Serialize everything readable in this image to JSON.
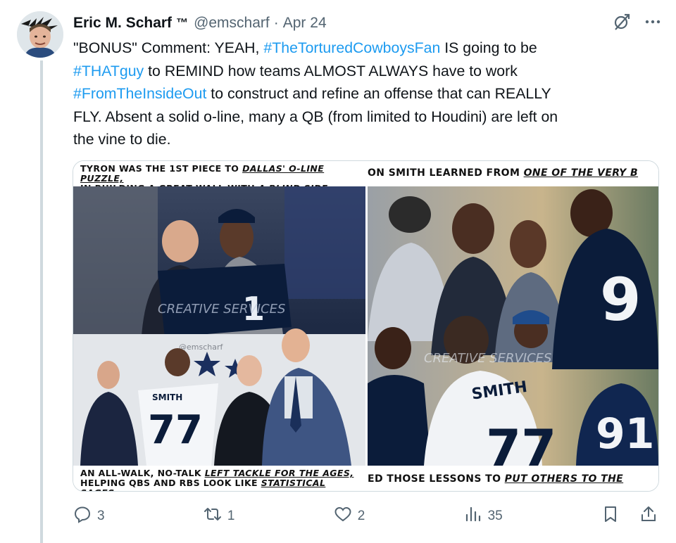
{
  "author": {
    "name": "Eric M. Scharf",
    "tm": "™",
    "handle": "@emscharf",
    "separator": "·",
    "date": "Apr 24"
  },
  "tweet": {
    "segments": [
      {
        "text": "\"BONUS\" Comment: YEAH, ",
        "type": "text"
      },
      {
        "text": "#TheTorturedCowboysFan",
        "type": "hashtag"
      },
      {
        "text": " IS going to be\n",
        "type": "text"
      },
      {
        "text": "#THATguy",
        "type": "hashtag"
      },
      {
        "text": " to REMIND how teams ALMOST ALWAYS have to work\n",
        "type": "text"
      },
      {
        "text": "#FromTheInsideOut",
        "type": "hashtag"
      },
      {
        "text": " to construct and refine an offense that can REALLY\nFLY. Absent a solid o-line, many a QB (from limited to Houdini) are left on\nthe vine to die.",
        "type": "text"
      }
    ]
  },
  "media": {
    "left": {
      "top_caption_line1_a": "TYRON WAS THE 1ST PIECE TO ",
      "top_caption_line1_b": "DALLAS' O-LINE PUZZLE,",
      "top_caption_line2_a": "IN BUILDING A GREAT WALL WITH ",
      "top_caption_line2_b": "A BLIND SIDE MUZZLE.",
      "bottom_caption_line1_a": "AN ALL-WALK, NO-TALK ",
      "bottom_caption_line1_b": "LEFT TACKLE FOR THE AGES,",
      "bottom_caption_line2_a": "HELPING QBS AND RBS LOOK LIKE ",
      "bottom_caption_line2_b": "STATISTICAL SAGES.",
      "jersey_name": "SMITH",
      "jersey_number": "77",
      "held_jersey_number": "1",
      "watermark": "CREATIVE SERVICES",
      "watermark2": "@emscharf"
    },
    "right": {
      "top_caption_a": "ON SMITH LEARNED FROM ",
      "top_caption_b": "ONE OF THE VERY B",
      "bottom_caption_a": "ED THOSE LESSONS TO ",
      "bottom_caption_b": "PUT OTHERS TO THE",
      "jersey_name": "SMITH",
      "jersey_number_a": "77",
      "jersey_number_b": "9",
      "jersey_number_c": "91",
      "watermark": "CREATIVE SERVICES"
    }
  },
  "actions": {
    "replies": "3",
    "reposts": "1",
    "likes": "2",
    "views": "35"
  },
  "colors": {
    "link": "#1d9bf0",
    "muted": "#536471",
    "text": "#0f1419",
    "cowboys_navy": "#0b1c3a"
  },
  "icons": [
    "grok-icon",
    "more-icon",
    "reply-icon",
    "repost-icon",
    "like-icon",
    "views-icon",
    "bookmark-icon",
    "share-icon"
  ]
}
